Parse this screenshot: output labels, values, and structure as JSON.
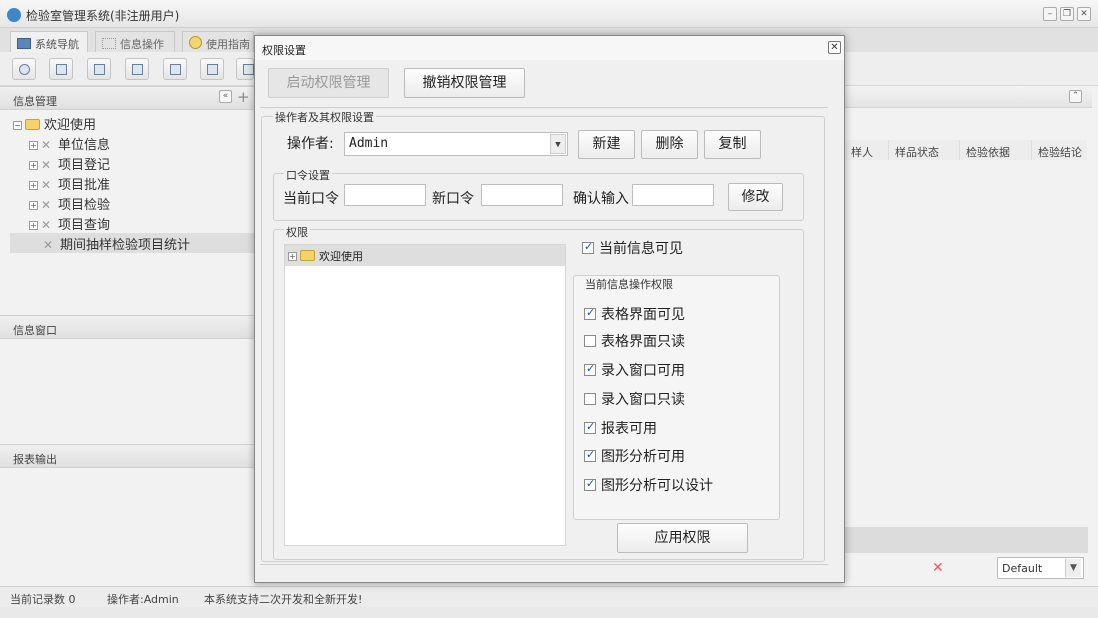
{
  "app": {
    "title": "检验室管理系统(非注册用户)"
  },
  "tabs": [
    {
      "label": "系统导航"
    },
    {
      "label": "信息操作"
    },
    {
      "label": "使用指南"
    }
  ],
  "sidebar": {
    "info_header": "信息管理",
    "tree_root": "欢迎使用",
    "tree_items": [
      "单位信息",
      "项目登记",
      "项目批准",
      "项目检验",
      "项目查询",
      "期间抽样检验项目统计"
    ],
    "window_header": "信息窗口",
    "report_header": "报表输出"
  },
  "table": {
    "columns": [
      "样人",
      "样品状态",
      "检验依据",
      "检验结论"
    ]
  },
  "bottom_right": {
    "select_value": "Default"
  },
  "status_bar": {
    "record_count": "当前记录数 0",
    "operator": "操作者:Admin",
    "message": "本系统支持二次开发和全新开发!"
  },
  "dialog": {
    "title": "权限设置",
    "start_button": "启动权限管理",
    "revoke_button": "撤销权限管理",
    "operator_section": "操作者及其权限设置",
    "operator_label": "操作者:",
    "operator_value": "Admin",
    "new_button": "新建",
    "delete_button": "删除",
    "copy_button": "复制",
    "password_section": "口令设置",
    "current_pw_label": "当前口令",
    "new_pw_label": "新口令",
    "confirm_label": "确认输入",
    "modify_button": "修改",
    "perm_section": "权限",
    "perm_tree_root": "欢迎使用",
    "visible_label": "当前信息可见",
    "ops_section": "当前信息操作权限",
    "perms": [
      {
        "label": "表格界面可见",
        "checked": true
      },
      {
        "label": "表格界面只读",
        "checked": false
      },
      {
        "label": "录入窗口可用",
        "checked": true
      },
      {
        "label": "录入窗口只读",
        "checked": false
      },
      {
        "label": "报表可用",
        "checked": true
      },
      {
        "label": "图形分析可用",
        "checked": true
      },
      {
        "label": "图形分析可以设计",
        "checked": true
      }
    ],
    "apply_button": "应用权限"
  }
}
